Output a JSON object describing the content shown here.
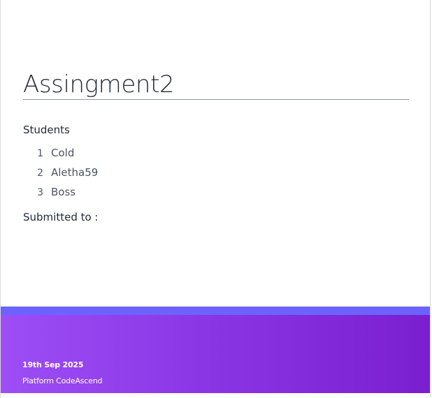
{
  "document": {
    "title": "Assingment2",
    "students_label": "Students",
    "students": [
      {
        "number": "1",
        "name": "Cold"
      },
      {
        "number": "2",
        "name": "Aletha59"
      },
      {
        "number": "3",
        "name": "Boss"
      }
    ],
    "submitted_label": "Submitted to :"
  },
  "footer": {
    "date": "19th Sep 2025",
    "platform": "Platform CodeAscend"
  },
  "colors": {
    "footer_strip": "#6c63ff",
    "footer_gradient_start": "#9d4ef5",
    "footer_gradient_end": "#7a1fcf",
    "title_rule": "#8f97a3"
  }
}
